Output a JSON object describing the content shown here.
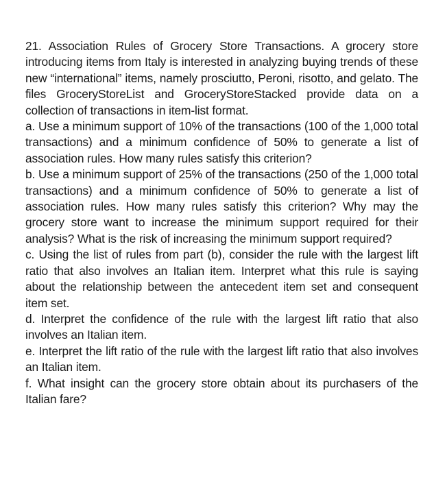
{
  "problem": {
    "number": "21.",
    "title": "Association Rules of Grocery Store Transactions.",
    "intro": "A grocery store introducing items from Italy is interested in analyzing buying trends of these new “international” items, namely prosciutto, Peroni, risotto, and gelato. The files GroceryStoreList and GroceryStoreStacked provide data on a collection of transac­tions in item-list format.",
    "parts": [
      {
        "label": "a.",
        "text": "Use a minimum support of 10% of the transactions (100 of the 1,000 total transactions) and a minimum confidence of 50% to generate a list of association rules. How many rules satisfy this criterion?"
      },
      {
        "label": "b.",
        "text": "Use a minimum support of 25% of the transactions (250 of the 1,000 total transactions) and a minimum confidence of 50% to generate a list of association rules. How many rules satisfy this criterion? Why may the grocery store want to increase the minimum support required for their analysis? What is the risk of increasing the minimum support required?"
      },
      {
        "label": "c.",
        "text": "Using the list of rules from part (b), consider the rule with the largest lift ratio that also involves an Italian item. Interpret what this rule is saying about the relationship between the antecedent item set and consequent item set."
      },
      {
        "label": "d.",
        "text": "Interpret the confidence of the rule with the largest lift ratio that also involves an Italian item."
      },
      {
        "label": "e.",
        "text": "Interpret the lift ratio of the rule with the largest lift ratio that also involves an Italian item."
      },
      {
        "label": "f.",
        "text": "What insight can the grocery store obtain about its purchasers of the Italian fare?"
      }
    ]
  }
}
